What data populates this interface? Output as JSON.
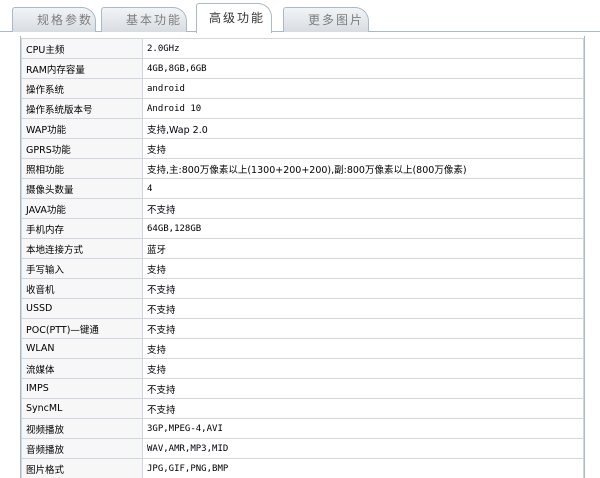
{
  "tabs": [
    {
      "label": "规格参数",
      "active": false
    },
    {
      "label": "基本功能",
      "active": false
    },
    {
      "label": "高级功能",
      "active": true
    },
    {
      "label": "更多图片",
      "active": false
    }
  ],
  "specs": [
    {
      "label": "CPU主频",
      "value": "2.0GHz"
    },
    {
      "label": "RAM内存容量",
      "value": "4GB,8GB,6GB"
    },
    {
      "label": "操作系统",
      "value": "android"
    },
    {
      "label": "操作系统版本号",
      "value": "Android 10"
    },
    {
      "label": "WAP功能",
      "value": "支持,Wap 2.0"
    },
    {
      "label": "GPRS功能",
      "value": "支持"
    },
    {
      "label": "照相功能",
      "value": "支持,主:800万像素以上(1300+200+200),副:800万像素以上(800万像素)"
    },
    {
      "label": "摄像头数量",
      "value": "4"
    },
    {
      "label": "JAVA功能",
      "value": "不支持"
    },
    {
      "label": "手机内存",
      "value": "64GB,128GB"
    },
    {
      "label": "本地连接方式",
      "value": "蓝牙"
    },
    {
      "label": "手写输入",
      "value": "支持"
    },
    {
      "label": "收音机",
      "value": "不支持"
    },
    {
      "label": "USSD",
      "value": "不支持"
    },
    {
      "label": "POC(PTT)—键通",
      "value": "不支持"
    },
    {
      "label": "WLAN",
      "value": "支持"
    },
    {
      "label": "流媒体",
      "value": "支持"
    },
    {
      "label": "IMPS",
      "value": "不支持"
    },
    {
      "label": "SyncML",
      "value": "不支持"
    },
    {
      "label": "视频播放",
      "value": "3GP,MPEG-4,AVI"
    },
    {
      "label": "音频播放",
      "value": "WAV,AMR,MP3,MID"
    },
    {
      "label": "图片格式",
      "value": "JPG,GIF,PNG,BMP"
    }
  ]
}
